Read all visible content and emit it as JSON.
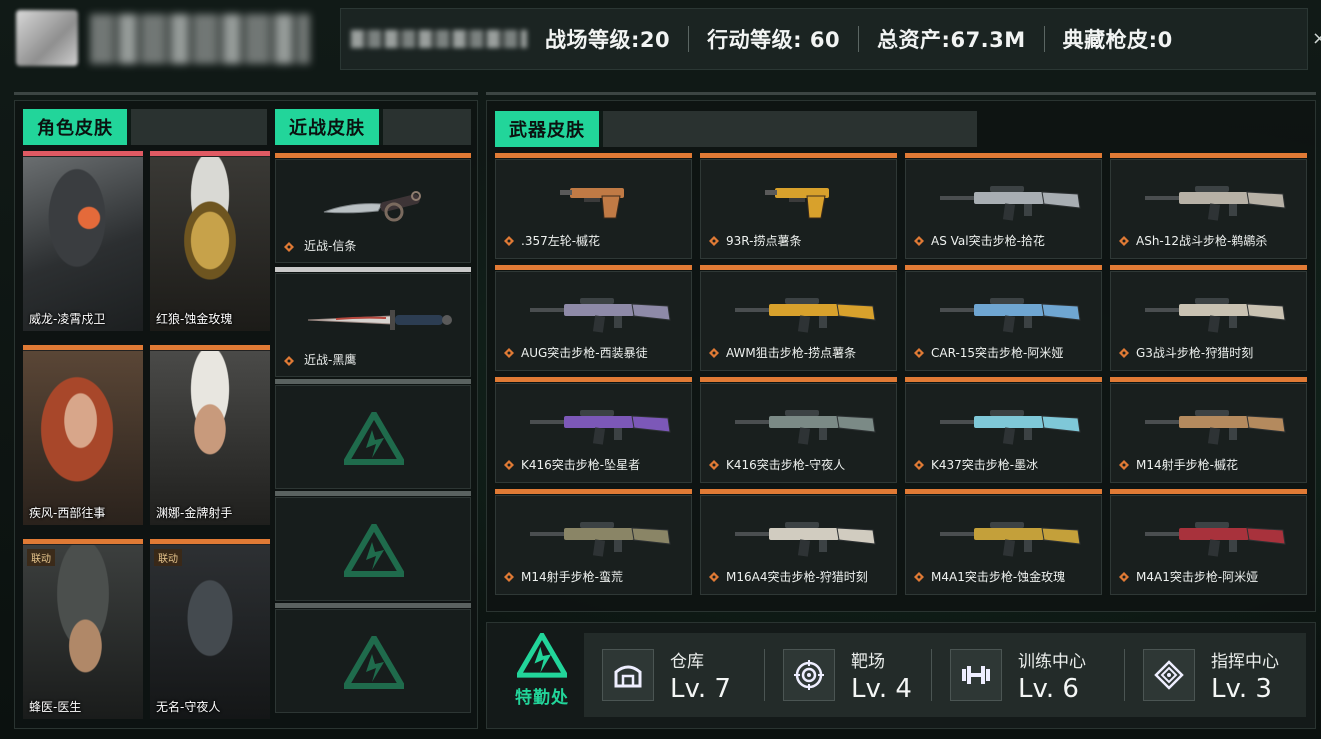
{
  "header": {
    "stats": [
      {
        "label": "战场等级:20"
      },
      {
        "label": "行动等级: 60"
      },
      {
        "label": "总资产:67.3M"
      },
      {
        "label": "典藏枪皮:0"
      }
    ],
    "close_icon": "×"
  },
  "sections": {
    "character_title": "角色皮肤",
    "melee_title": "近战皮肤",
    "weapon_title": "武器皮肤"
  },
  "character_skins": [
    {
      "name": "威龙-凌霄戍卫",
      "tag": "",
      "rarity_color": "#e05a63",
      "portrait": "soldier-visor"
    },
    {
      "name": "红狼-蚀金玫瑰",
      "tag": "",
      "rarity_color": "#e05a63",
      "portrait": "gold-skull"
    },
    {
      "name": "疾风-西部往事",
      "tag": "",
      "rarity_color": "#e07a35",
      "portrait": "redhair"
    },
    {
      "name": "渊娜-金牌射手",
      "tag": "",
      "rarity_color": "#e07a35",
      "portrait": "headset-girl"
    },
    {
      "name": "蜂医-医生",
      "tag": "联动",
      "rarity_color": "#e07a35",
      "portrait": "helmet-man"
    },
    {
      "name": "无名-守夜人",
      "tag": "联动",
      "rarity_color": "#e07a35",
      "portrait": "masked-man"
    }
  ],
  "melee_skins": [
    {
      "name": "近战-信条",
      "rarity_color": "#e07a35",
      "icon": "karambit-knife-icon"
    },
    {
      "name": "近战-黑鹰",
      "rarity_color": "#c9c9c9",
      "icon": "combat-knife-icon"
    }
  ],
  "weapon_skins": [
    {
      "name": ".357左轮-槭花",
      "color": "#c07a45"
    },
    {
      "name": "93R-捞点薯条",
      "color": "#d8a12c"
    },
    {
      "name": "AS Val突击步枪-拾花",
      "color": "#a8aeb3"
    },
    {
      "name": "ASh-12战斗步枪-鹈鹕杀",
      "color": "#b7b1a6"
    },
    {
      "name": "AUG突击步枪-西装暴徒",
      "color": "#8e8aa8"
    },
    {
      "name": "AWM狙击步枪-捞点薯条",
      "color": "#d8a12c"
    },
    {
      "name": "CAR-15突击步枪-阿米娅",
      "color": "#6fa6d2"
    },
    {
      "name": "G3战斗步枪-狩猎时刻",
      "color": "#c9c2b2"
    },
    {
      "name": "K416突击步枪-坠星者",
      "color": "#7c58b8"
    },
    {
      "name": "K416突击步枪-守夜人",
      "color": "#7b8a86"
    },
    {
      "name": "K437突击步枪-墨冰",
      "color": "#7fc8d8"
    },
    {
      "name": "M14射手步枪-槭花",
      "color": "#b48a5e"
    },
    {
      "name": "M14射手步枪-蛮荒",
      "color": "#8a8566"
    },
    {
      "name": "M16A4突击步枪-狩猎时刻",
      "color": "#d1ccc0"
    },
    {
      "name": "M4A1突击步枪-蚀金玫瑰",
      "color": "#c4a03a"
    },
    {
      "name": "M4A1突击步枪-阿米娅",
      "color": "#a8323c"
    }
  ],
  "bottom": {
    "department_label": "特勤处",
    "facilities": [
      {
        "name": "仓库",
        "level": "Lv. 7",
        "icon": "warehouse-icon"
      },
      {
        "name": "靶场",
        "level": "Lv. 4",
        "icon": "target-icon"
      },
      {
        "name": "训练中心",
        "level": "Lv. 6",
        "icon": "dumbbell-icon"
      },
      {
        "name": "指挥中心",
        "level": "Lv. 3",
        "icon": "command-icon"
      }
    ]
  },
  "colors": {
    "accent_green": "#22d59a",
    "orange_rarity": "#e07a35",
    "red_rarity": "#e05a63"
  }
}
